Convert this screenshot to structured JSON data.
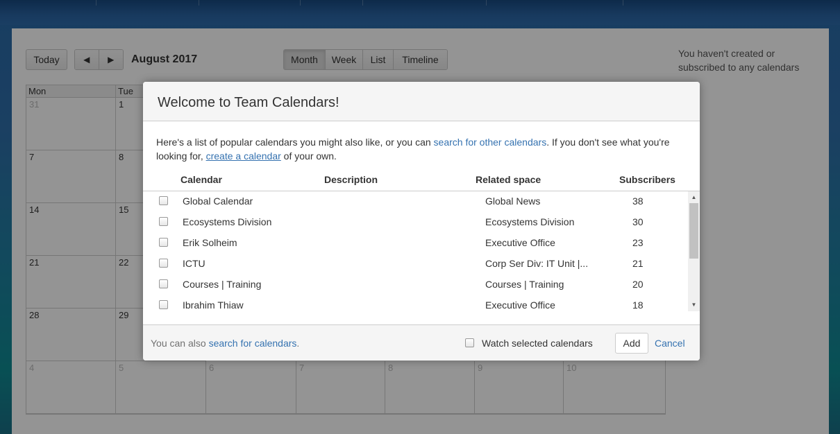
{
  "toolbar": {
    "today_label": "Today",
    "prev_glyph": "◀",
    "next_glyph": "▶",
    "month_title": "August 2017",
    "views": [
      "Month",
      "Week",
      "List",
      "Timeline"
    ],
    "active_view": "Month"
  },
  "side_note": "You haven't created or subscribed to any calendars",
  "calendar": {
    "day_headers": [
      "Mon",
      "Tue"
    ],
    "weeks": [
      [
        "31",
        "1"
      ],
      [
        "7",
        "8"
      ],
      [
        "14",
        "15"
      ],
      [
        "21",
        "22"
      ],
      [
        "28",
        "29"
      ],
      [
        "4",
        "5",
        "6",
        "7",
        "8",
        "9",
        "10"
      ]
    ]
  },
  "dialog": {
    "title": "Welcome to Team Calendars!",
    "intro_1": "Here's a list of popular calendars you might also like, or you can ",
    "intro_link_search": "search for other calendars",
    "intro_2": ". If you don't see what you're looking for, ",
    "intro_link_create": "create a calendar",
    "intro_3": " of your own.",
    "columns": {
      "calendar": "Calendar",
      "description": "Description",
      "related_space": "Related space",
      "subscribers": "Subscribers"
    },
    "rows": [
      {
        "calendar": "Global Calendar",
        "space": "Global News",
        "subscribers": "38"
      },
      {
        "calendar": "Ecosystems Division",
        "space": "Ecosystems Division",
        "subscribers": "30"
      },
      {
        "calendar": "Erik Solheim",
        "space": "Executive Office",
        "subscribers": "23"
      },
      {
        "calendar": "ICTU",
        "space": "Corp Ser Div: IT Unit |...",
        "subscribers": "21"
      },
      {
        "calendar": "Courses | Training",
        "space": "Courses | Training",
        "subscribers": "20"
      },
      {
        "calendar": "Ibrahim Thiaw",
        "space": "Executive Office",
        "subscribers": "18"
      }
    ],
    "footer_text": "You can also ",
    "footer_link": "search for calendars",
    "footer_period": ".",
    "watch_label": "Watch selected calendars",
    "add_label": "Add",
    "cancel_label": "Cancel"
  }
}
